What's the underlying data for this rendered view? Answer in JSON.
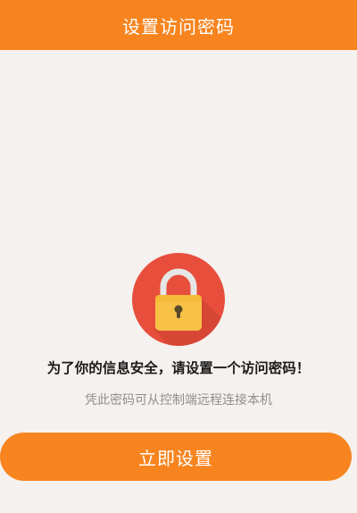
{
  "header": {
    "title": "设置访问密码"
  },
  "main": {
    "lock_icon": "padlock-icon",
    "notice": "为了你的信息安全，请设置一个访问密码！",
    "subnotice": "凭此密码可从控制端远程连接本机"
  },
  "action": {
    "button_label": "立即设置"
  },
  "colors": {
    "accent": "#f7841e",
    "background": "#f5f1ee",
    "lock_circle": "#e84e3c",
    "lock_body": "#f8c247"
  }
}
